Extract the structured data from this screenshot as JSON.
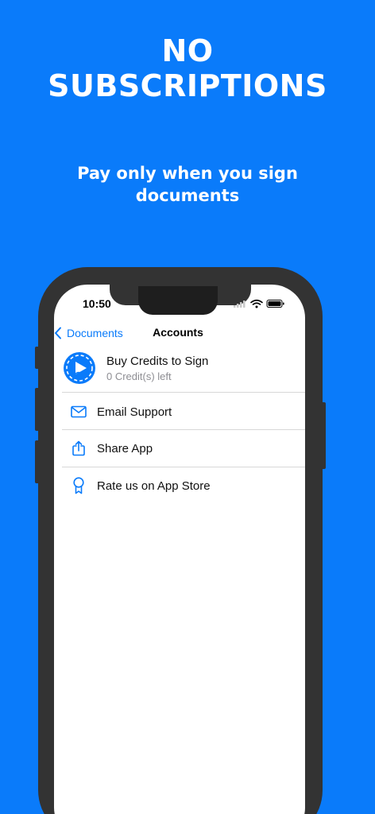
{
  "promo": {
    "headline_line1": "NO",
    "headline_line2": "SUBSCRIPTIONS",
    "subline": "Pay only when you sign documents"
  },
  "status_bar": {
    "time": "10:50"
  },
  "nav": {
    "back_label": "Documents",
    "title": "Accounts"
  },
  "credits": {
    "label": "Buy Credits to Sign",
    "subtitle": "0 Credit(s) left",
    "icon": "signature-play-icon"
  },
  "menu": [
    {
      "label": "Email Support",
      "icon": "envelope-icon"
    },
    {
      "label": "Share App",
      "icon": "share-icon"
    },
    {
      "label": "Rate us on App Store",
      "icon": "award-ribbon-icon"
    }
  ],
  "colors": {
    "background": "#0A7BFA",
    "accent": "#0A7BFA",
    "phone_frame": "#333333"
  }
}
